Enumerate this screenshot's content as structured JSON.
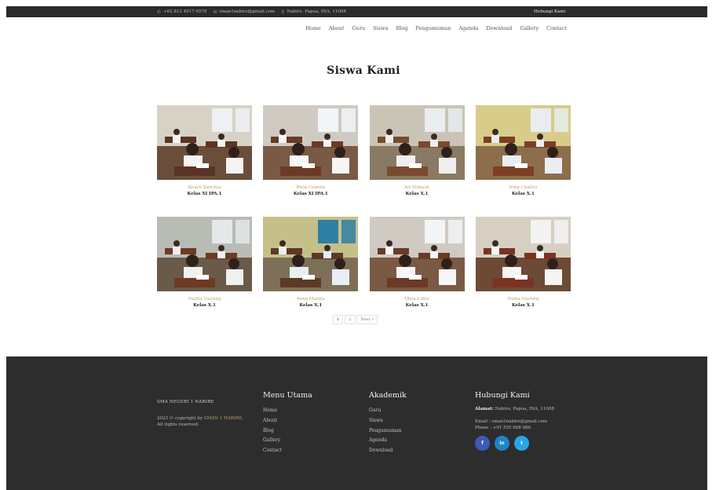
{
  "topbar": {
    "phone": "+62 812 4017 0578",
    "email": "sman1nabire@gmail.com",
    "address": "Nabire, Papua, INA, 11008",
    "contact_label": "Hubungi Kami",
    "icons": [
      "phone-icon",
      "mail-icon",
      "map-pin-icon"
    ]
  },
  "nav": [
    "Home",
    "About",
    "Guru",
    "Siswa",
    "Blog",
    "Pengumuman",
    "Agenda",
    "Download",
    "Gallery",
    "Contact"
  ],
  "page_title": "Siswa Kami",
  "students": [
    {
      "name": "Alvaro Sanchez",
      "class": "Kelas XI IPA.1",
      "scene": "a"
    },
    {
      "name": "Rizia Camilia",
      "class": "Kelas XI IPA.1",
      "scene": "b"
    },
    {
      "name": "Ari Hidayat",
      "class": "Kelas X.1",
      "scene": "c"
    },
    {
      "name": "Irma Chaitra",
      "class": "Kelas X.1",
      "scene": "d"
    },
    {
      "name": "Nadila Gusting",
      "class": "Kelas X.1",
      "scene": "e"
    },
    {
      "name": "Anna Marina",
      "class": "Kelas X.1",
      "scene": "f"
    },
    {
      "name": "Dhea Lubis",
      "class": "Kelas X.1",
      "scene": "b"
    },
    {
      "name": "Nadia Gusting",
      "class": "Kelas X.1",
      "scene": "g"
    }
  ],
  "pagination": {
    "pages": [
      "1",
      "2"
    ],
    "next": "Next »",
    "current": "1"
  },
  "footer": {
    "school_name": "SMA NEGERI 1 NABIRE",
    "copyright_prefix": "2023 © copyright by",
    "copyright_link": "SMAN 1 NABIRE",
    "rights": "All rights reserved.",
    "menu_title": "Menu Utama",
    "menu_items": [
      "Home",
      "About",
      "Blog",
      "Gallery",
      "Contact"
    ],
    "academic_title": "Akademik",
    "academic_items": [
      "Guru",
      "Siswa",
      "Pengumuman",
      "Agenda",
      "Download"
    ],
    "contact_title": "Hubungi Kami",
    "address_label": "Alamat:",
    "address_value": "Nabire, Papua, INA, 11008",
    "email_line": "Email : sman1nabire@gmail.com",
    "phone_line": "Phone : +91 555 668 986",
    "social": [
      {
        "icon": "facebook-icon",
        "glyph": "f",
        "color": "#3b5bb5"
      },
      {
        "icon": "linkedin-icon",
        "glyph": "in",
        "color": "#1f84c8"
      },
      {
        "icon": "twitter-icon",
        "glyph": "t",
        "color": "#2aa4e8"
      }
    ]
  }
}
